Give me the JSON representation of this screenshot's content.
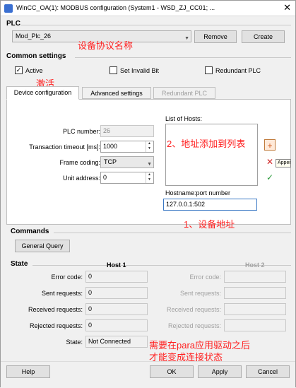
{
  "window": {
    "title": "WinCC_OA(1): MODBUS configuration (System1 - WSD_ZJ_CC01; ...",
    "close_glyph": "✕"
  },
  "plc": {
    "section_label": "PLC",
    "selected_value": "Mod_Plc_26",
    "remove_label": "Remove",
    "create_label": "Create",
    "annotation": "设备协议名称"
  },
  "common_settings": {
    "section_label": "Common settings",
    "active_label": "Active",
    "active_checked": true,
    "set_invalid_bit_label": "Set Invalid Bit",
    "set_invalid_bit_checked": false,
    "redundant_plc_label": "Redundant PLC",
    "redundant_plc_checked": false,
    "annotation": "激活"
  },
  "tabs": [
    {
      "label": "Device configuration",
      "active": true,
      "disabled": false
    },
    {
      "label": "Advanced settings",
      "active": false,
      "disabled": false
    },
    {
      "label": "Redundant PLC",
      "active": false,
      "disabled": true
    }
  ],
  "device_config": {
    "plc_number_label": "PLC number:",
    "plc_number_value": "26",
    "transaction_timeout_label": "Transaction timeout [ms]:",
    "transaction_timeout_value": "1000",
    "frame_coding_label": "Frame coding:",
    "frame_coding_value": "TCP",
    "unit_address_label": "Unit address:",
    "unit_address_value": "0",
    "list_of_hosts_label": "List of Hosts:",
    "hosts_annotation": "2、地址添加到列表",
    "hostname_port_label": "Hostname:port number",
    "hostname_port_value": "127.0.0.1:502",
    "address_annotation": "1、设备地址",
    "append_tooltip": "Append"
  },
  "commands": {
    "section_label": "Commands",
    "general_query_label": "General Query"
  },
  "state": {
    "section_label": "State",
    "host1_label": "Host 1",
    "host2_label": "Host 2",
    "rows": [
      {
        "label": "Error code:",
        "value1": "0",
        "value2": ""
      },
      {
        "label": "Sent requests:",
        "value1": "0",
        "value2": ""
      },
      {
        "label": "Received requests:",
        "value1": "0",
        "value2": ""
      },
      {
        "label": "Rejected requests:",
        "value1": "0",
        "value2": ""
      }
    ],
    "state_label": "State:",
    "state_value": "Not Connected",
    "annotation_line1": "需要在para应用驱动之后",
    "annotation_line2": "才能变成连接状态"
  },
  "footer": {
    "help_label": "Help",
    "ok_label": "OK",
    "apply_label": "Apply",
    "cancel_label": "Cancel"
  }
}
